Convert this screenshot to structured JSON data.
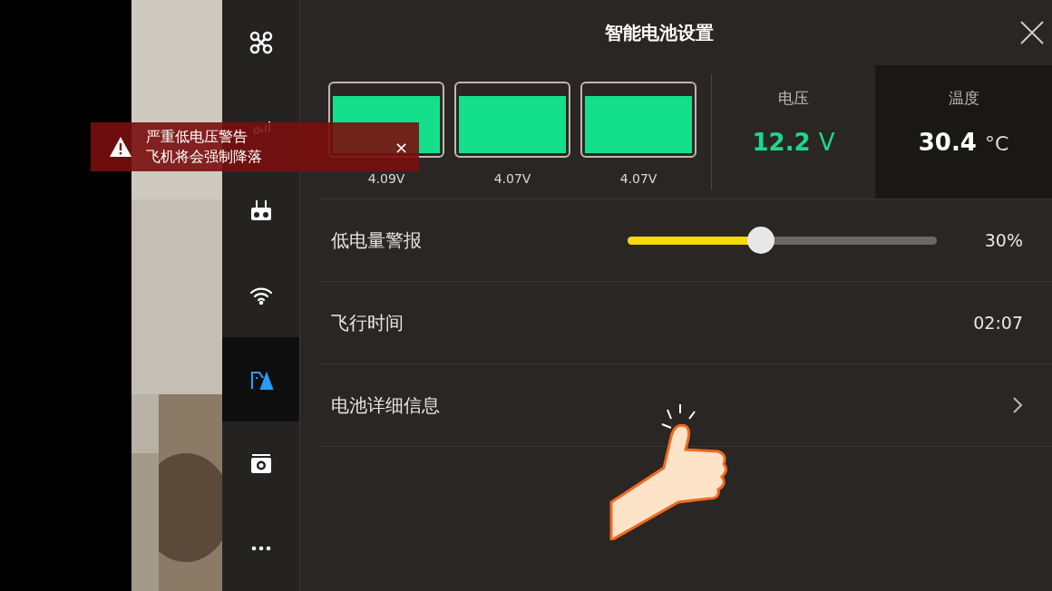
{
  "window": {
    "title": "智能电池设置"
  },
  "sidebar": {
    "items": [
      {
        "kind": "drone",
        "selected": false
      },
      {
        "kind": "signal",
        "selected": false
      },
      {
        "kind": "remote",
        "selected": false
      },
      {
        "kind": "wifi",
        "selected": false
      },
      {
        "kind": "battery",
        "selected": true
      },
      {
        "kind": "camera",
        "selected": false
      },
      {
        "kind": "more",
        "selected": false
      }
    ]
  },
  "cells": [
    {
      "reading": "4.09V"
    },
    {
      "reading": "4.07V"
    },
    {
      "reading": "4.07V"
    }
  ],
  "voltage": {
    "label": "电压",
    "value": "12.2",
    "unit": "V"
  },
  "temperature": {
    "label": "温度",
    "value": "30.4",
    "unit": "°C"
  },
  "settings": [
    {
      "kind": "slider",
      "label": "低电量警报",
      "level": 0.43,
      "reading": "30%"
    },
    {
      "kind": "value",
      "label": "飞行时间",
      "reading": "02:07"
    },
    {
      "kind": "link",
      "label": "电池详细信息"
    }
  ],
  "warning": {
    "lines": [
      "严重低电压警告",
      "飞机将会强制降落"
    ],
    "close": "×"
  }
}
